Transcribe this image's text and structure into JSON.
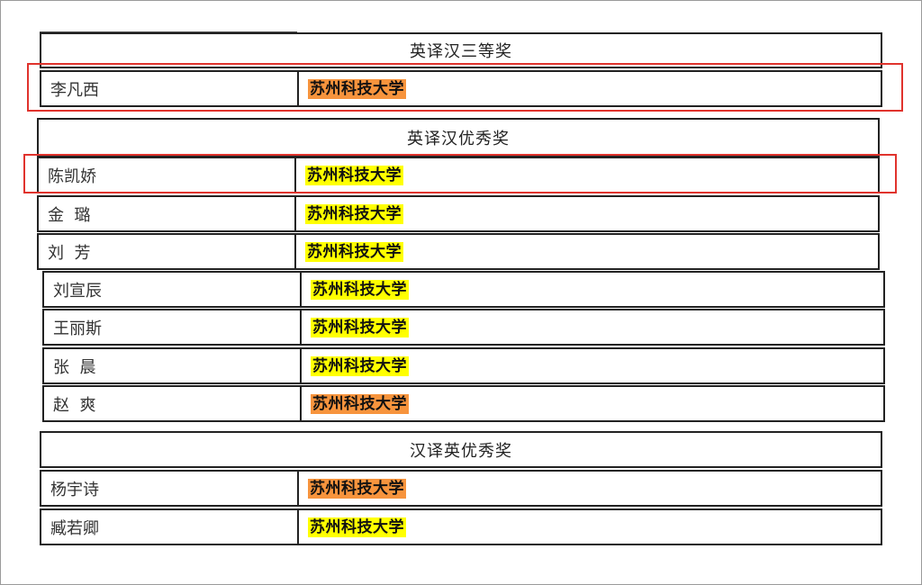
{
  "sections": [
    {
      "title": "英译汉三等奖",
      "rows": [
        {
          "name": "李凡西",
          "affiliation": "苏州科技大学",
          "highlight": "orange"
        }
      ]
    },
    {
      "title": "英译汉优秀奖",
      "rows": [
        {
          "name": "陈凯娇",
          "affiliation": "苏州科技大学",
          "highlight": "yellow"
        },
        {
          "name": "金  璐",
          "affiliation": "苏州科技大学",
          "highlight": "yellow"
        },
        {
          "name": "刘  芳",
          "affiliation": "苏州科技大学",
          "highlight": "yellow"
        },
        {
          "name": "刘宣辰",
          "affiliation": "苏州科技大学",
          "highlight": "yellow"
        },
        {
          "name": "王丽斯",
          "affiliation": "苏州科技大学",
          "highlight": "yellow"
        },
        {
          "name": "张  晨",
          "affiliation": "苏州科技大学",
          "highlight": "yellow"
        },
        {
          "name": "赵  爽",
          "affiliation": "苏州科技大学",
          "highlight": "orange"
        }
      ]
    },
    {
      "title": "汉译英优秀奖",
      "rows": [
        {
          "name": "杨宇诗",
          "affiliation": "苏州科技大学",
          "highlight": "orange"
        },
        {
          "name": "臧若卿",
          "affiliation": "苏州科技大学",
          "highlight": "yellow"
        }
      ]
    }
  ],
  "colors": {
    "highlight_yellow": "#ffff00",
    "highlight_orange": "#f7943d",
    "annotation_red": "#e0332d"
  }
}
